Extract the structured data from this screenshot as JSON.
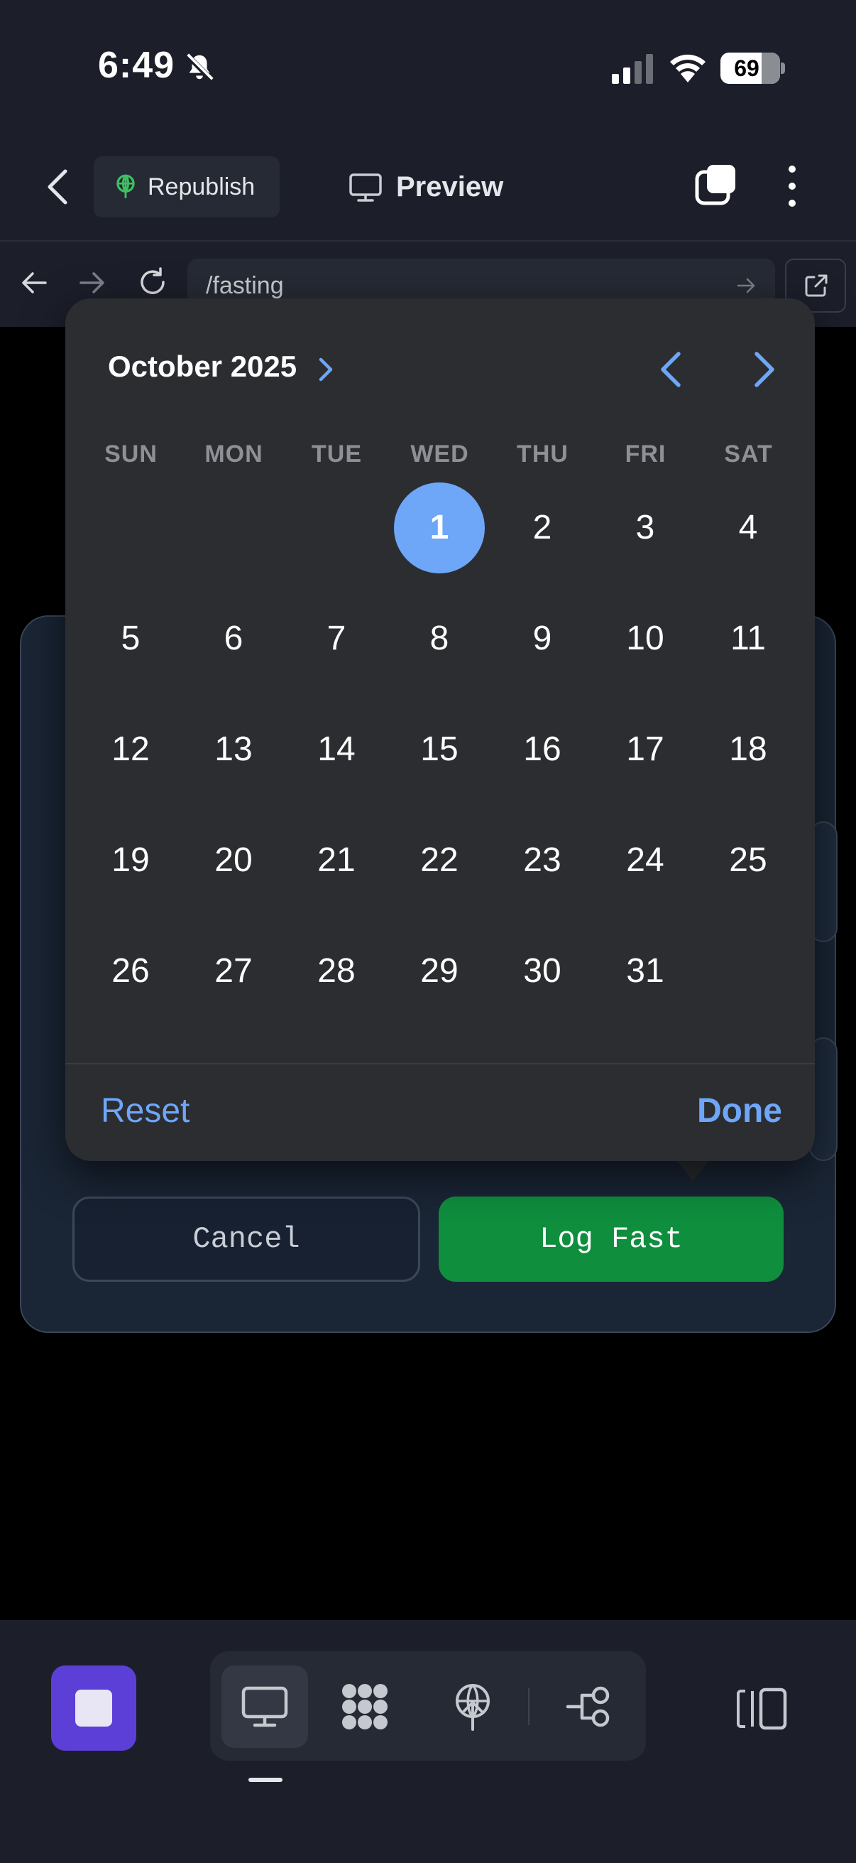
{
  "status_bar": {
    "time": "6:49",
    "battery": "69"
  },
  "app_bar": {
    "republish_label": "Republish",
    "preview_label": "Preview"
  },
  "browser": {
    "url": "/fasting"
  },
  "date_picker": {
    "month_label": "October 2025",
    "weekdays": [
      "SUN",
      "MON",
      "TUE",
      "WED",
      "THU",
      "FRI",
      "SAT"
    ],
    "days": [
      "1",
      "2",
      "3",
      "4",
      "5",
      "6",
      "7",
      "8",
      "9",
      "10",
      "11",
      "12",
      "13",
      "14",
      "15",
      "16",
      "17",
      "18",
      "19",
      "20",
      "21",
      "22",
      "23",
      "24",
      "25",
      "26",
      "27",
      "28",
      "29",
      "30",
      "31"
    ],
    "selected_day": "1",
    "reset_label": "Reset",
    "done_label": "Done",
    "accent_color": "#6ea6f8"
  },
  "form": {
    "cancel_label": "Cancel",
    "submit_label": "Log Fast",
    "submit_color": "#0f8e3e"
  },
  "toolbar": {
    "stop_color": "#5b3fd6",
    "tools": [
      "monitor-icon",
      "apps-grid-icon",
      "publish-antenna-icon",
      "workflow-icon"
    ],
    "active_tool": "monitor-icon",
    "panel": "side-panel-icon"
  }
}
